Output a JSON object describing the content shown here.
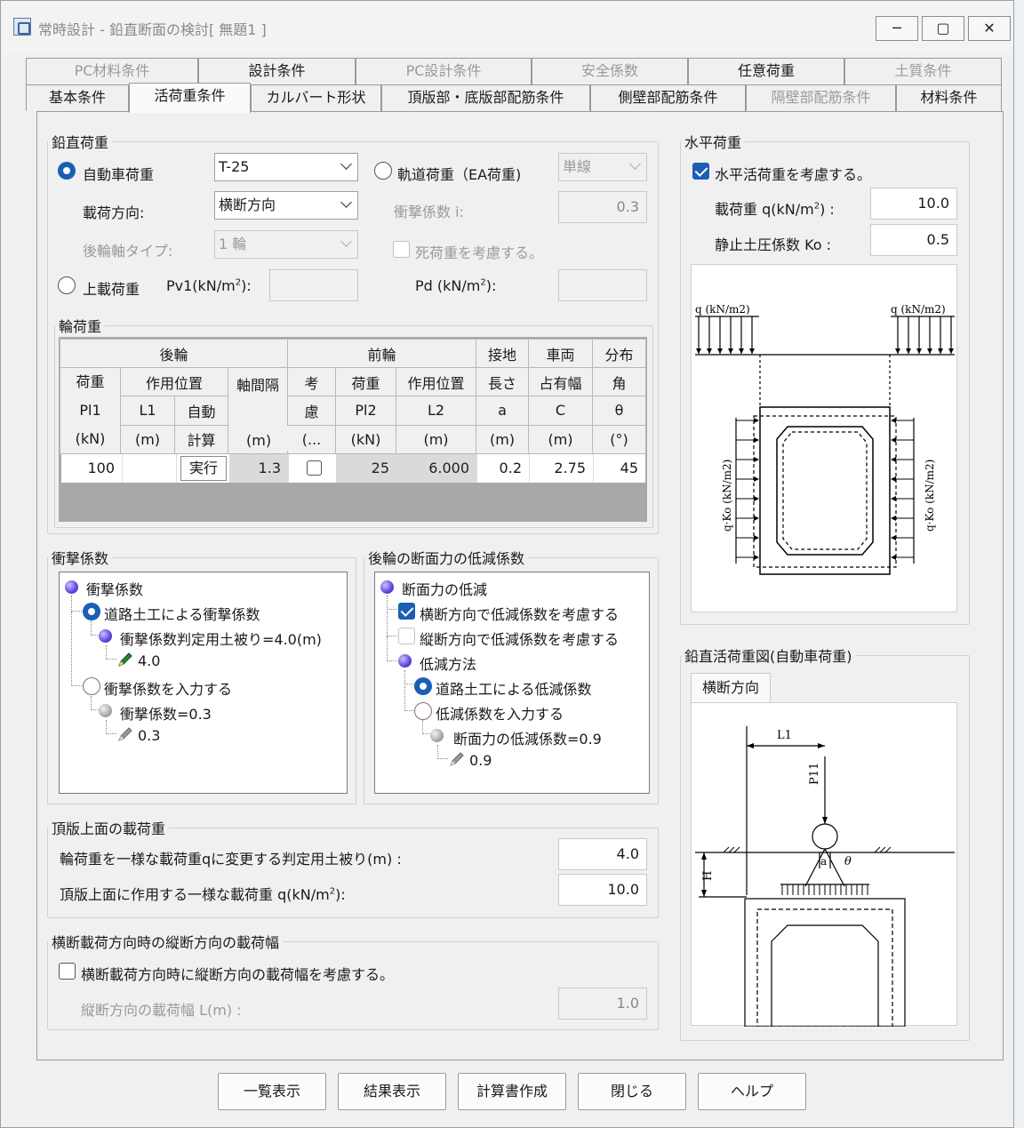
{
  "window": {
    "title": "常時設計 - 鉛直断面の検討[ 無題1 ]",
    "min_icon": "minimize-icon",
    "max_icon": "maximize-icon",
    "close_icon": "close-icon",
    "min_glyph": "─",
    "max_glyph": "▢",
    "close_glyph": "✕"
  },
  "tabs_row1": [
    {
      "label": "PC材料条件",
      "disabled": true
    },
    {
      "label": "設計条件",
      "disabled": false
    },
    {
      "label": "PC設計条件",
      "disabled": true
    },
    {
      "label": "安全係数",
      "disabled": true
    },
    {
      "label": "任意荷重",
      "disabled": false
    },
    {
      "label": "土質条件",
      "disabled": true
    }
  ],
  "tabs_row2": [
    {
      "label": "基本条件",
      "disabled": false
    },
    {
      "label": "活荷重条件",
      "active": true
    },
    {
      "label": "カルバート形状",
      "disabled": false
    },
    {
      "label": "頂版部・底版部配筋条件",
      "disabled": false
    },
    {
      "label": "側壁部配筋条件",
      "disabled": false
    },
    {
      "label": "隔壁部配筋条件",
      "disabled": true
    },
    {
      "label": "材料条件",
      "disabled": false
    }
  ],
  "vertical": {
    "legend": "鉛直荷重",
    "car_label": "自動車荷重",
    "car_value": "T-25",
    "rail_label": "軌道荷重（EA荷重)",
    "rail_value": "単線",
    "dir_label": "載荷方向:",
    "dir_value": "横断方向",
    "impact_label": "衝撃係数 i:",
    "impact_value": "0.3",
    "rear_label": "後輪軸タイプ:",
    "rear_value": "1 輪",
    "dead_label": "死荷重を考慮する。",
    "upper_label": "上載荷重",
    "pv1_label": "Pv1(kN/m",
    "pd_label": "Pd (kN/m",
    "sup2": "2",
    "close_paren": "):"
  },
  "wheel": {
    "legend": "輪荷重",
    "h_rear": "後輪",
    "h_front": "前輪",
    "h_ground": "接地",
    "h_vehicle": "車両",
    "h_dist": "分布",
    "h_load": "荷重",
    "h_pos": "作用位置",
    "h_axle": "軸間隔",
    "h_cons": "考",
    "h_load2": "荷重",
    "h_pos2": "作用位置",
    "h_len": "長さ",
    "h_width": "占有幅",
    "h_angle": "角",
    "h_pl1": "Pl1",
    "h_l1": "L1",
    "h_auto": "自動",
    "h_cons2": "慮",
    "h_pl2": "Pl2",
    "h_l2": "L2",
    "h_a": "a",
    "h_c": "C",
    "h_theta": "θ",
    "u_kn": "(kN)",
    "u_m": "(m)",
    "h_calc": "計算",
    "u_m2": "(m)",
    "h_cons3": "(...",
    "u_kn2": "(kN)",
    "u_m3": "(m)",
    "u_m4": "(m)",
    "u_m5": "(m)",
    "u_deg": "(°)",
    "row": {
      "pl1": "100",
      "l1": "",
      "exec": "実行",
      "axle": "1.3",
      "pl2": "25",
      "l2": "6.000",
      "a": "0.2",
      "c": "2.75",
      "theta": "45"
    }
  },
  "impact": {
    "legend": "衝撃係数",
    "root": "衝撃係数",
    "opt1": "道路土工による衝撃係数",
    "cover": "衝撃係数判定用土被り=4.0(m)",
    "cover_val": "4.0",
    "opt2": "衝撃係数を入力する",
    "factor": "衝撃係数=0.3",
    "factor_val": "0.3"
  },
  "reduction": {
    "legend": "後輪の断面力の低減係数",
    "root": "断面力の低減",
    "chk1": "横断方向で低減係数を考慮する",
    "chk2": "縦断方向で低減係数を考慮する",
    "method": "低減方法",
    "opt1": "道路土工による低減係数",
    "opt2": "低減係数を入力する",
    "factor": "断面力の低減係数=0.9",
    "factor_val": "0.9"
  },
  "top": {
    "legend": "頂版上面の載荷重",
    "l1": "輪荷重を一様な載荷重qに変更する判定用土被り(m) :",
    "v1": "4.0",
    "l2": "頂版上面に作用する一様な載荷重 q(kN/m",
    "l2b": "):",
    "v2": "10.0"
  },
  "width": {
    "legend": "横断載荷方向時の縦断方向の載荷幅",
    "chk": "横断載荷方向時に縦断方向の載荷幅を考慮する。",
    "l": "縦断方向の載荷幅 L(m) :",
    "v": "1.0"
  },
  "horizontal": {
    "legend": "水平荷重",
    "chk": "水平活荷重を考慮する。",
    "q_label": "載荷重 q(kN/m",
    "q_label_b": ") :",
    "q_val": "10.0",
    "ko_label": "静止土圧係数 Ko :",
    "ko_val": "0.5"
  },
  "hdiag": {
    "q_left": "q (kN/m2)",
    "q_right": "q (kN/m2)",
    "side_left": "q·Ko (kN/m2)",
    "side_right": "q·Ko (kN/m2)"
  },
  "vdiag": {
    "legend": "鉛直活荷重図(自動車荷重)",
    "tab": "横断方向",
    "L1": "L1",
    "P11": "P11",
    "H": "H",
    "a": "a",
    "theta": "θ"
  },
  "buttons": [
    "一覧表示",
    "結果表示",
    "計算書作成",
    "閉じる",
    "ヘルプ"
  ]
}
